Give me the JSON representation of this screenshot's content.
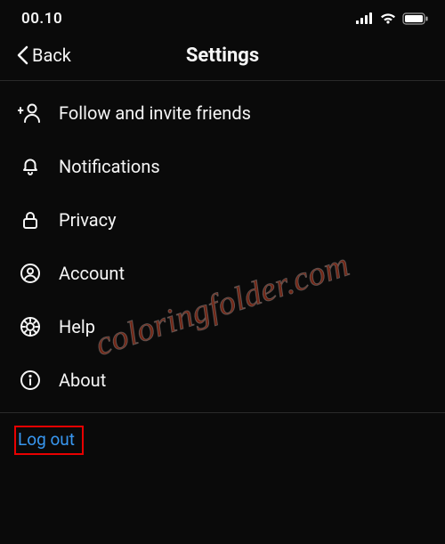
{
  "status": {
    "time": "00.10"
  },
  "nav": {
    "back": "Back",
    "title": "Settings"
  },
  "menu": {
    "items": [
      {
        "label": "Follow and invite friends"
      },
      {
        "label": "Notifications"
      },
      {
        "label": "Privacy"
      },
      {
        "label": "Account"
      },
      {
        "label": "Help"
      },
      {
        "label": "About"
      }
    ]
  },
  "logout": {
    "label": "Log out"
  },
  "watermark": "coloringfolder.com"
}
